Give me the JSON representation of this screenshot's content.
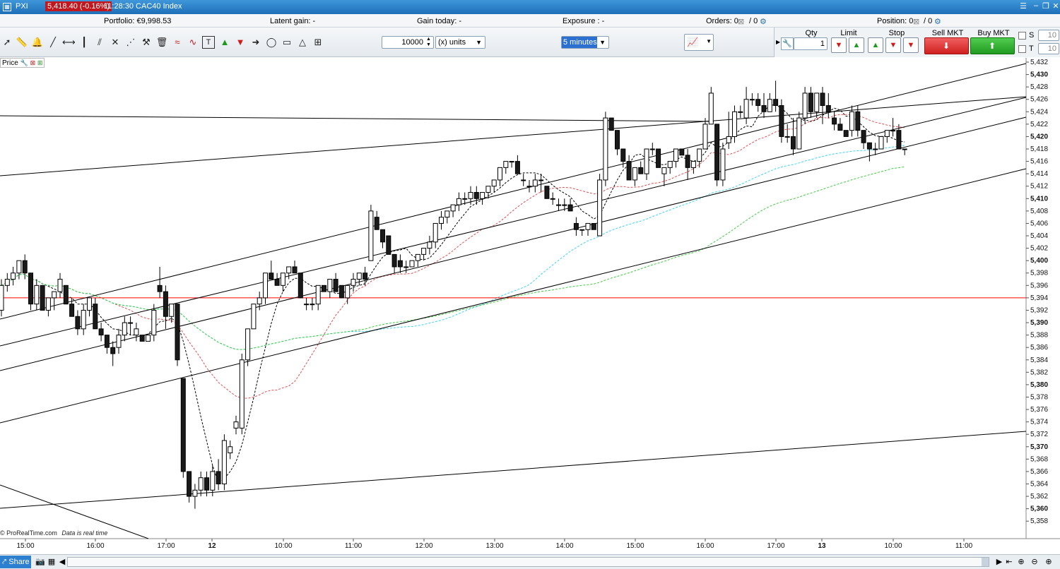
{
  "titlebar": {
    "symbol": "PXI",
    "last_price": "5,418.40 (-0.16%)",
    "info": "11:28:30 CAC40 Index"
  },
  "status": {
    "portfolio": "Portfolio: €9,998.53",
    "latent": "Latent gain: -",
    "gain_today": "Gain today: -",
    "exposure": "Exposure : -",
    "orders_label": "Orders: 0",
    "orders_sep": "/ 0",
    "position_label": "Position: 0",
    "position_sep": "/ 0"
  },
  "toolbar": {
    "quantity_value": "10000",
    "units_label": "(x) units",
    "timeframe": "5 minutes"
  },
  "order_panel": {
    "qty_label": "Qty",
    "qty_value": "1",
    "limit_label": "Limit",
    "stop_label": "Stop",
    "sell_label": "Sell MKT",
    "buy_label": "Buy MKT",
    "s_label": "S",
    "t_label": "T",
    "s_value": "10",
    "t_value": "10"
  },
  "chart_header": {
    "price_label": "Price"
  },
  "credit": {
    "brand": "© ProRealTime.com",
    "note": "Data is real time"
  },
  "footer": {
    "share_label": "Share"
  },
  "chart_data": {
    "type": "candlestick",
    "y_axis": {
      "min": 5357,
      "max": 5432,
      "ticks": [
        "5,432",
        "5,430",
        "5,428",
        "5,426",
        "5,424",
        "5,422",
        "5,420",
        "5,418",
        "5,416",
        "5,414",
        "5,412",
        "5,410",
        "5,408",
        "5,406",
        "5,404",
        "5,402",
        "5,400",
        "5,398",
        "5,396",
        "5,394",
        "5,392",
        "5,390",
        "5,388",
        "5,386",
        "5,384",
        "5,382",
        "5,380",
        "5,378",
        "5,376",
        "5,374",
        "5,372",
        "5,370",
        "5,368",
        "5,366",
        "5,364",
        "5,362",
        "5,360",
        "5,358"
      ]
    },
    "x_axis": {
      "labels": [
        "15:00",
        "16:00",
        "17:00",
        "12",
        "10:00",
        "11:00",
        "12:00",
        "13:00",
        "14:00",
        "15:00",
        "16:00",
        "17:00",
        "13",
        "10:00",
        "11:00"
      ]
    },
    "reference_line": 5394,
    "candles": [
      [
        5392,
        5397,
        5391,
        5396
      ],
      [
        5396,
        5398,
        5395,
        5397
      ],
      [
        5397,
        5399,
        5396,
        5398
      ],
      [
        5398,
        5400,
        5397,
        5400
      ],
      [
        5400,
        5401,
        5397,
        5398
      ],
      [
        5398,
        5398,
        5392,
        5393
      ],
      [
        5393,
        5397,
        5392,
        5396
      ],
      [
        5396,
        5396,
        5392,
        5392
      ],
      [
        5392,
        5394,
        5391,
        5394
      ],
      [
        5394,
        5395,
        5392,
        5395
      ],
      [
        5395,
        5398,
        5394,
        5397
      ],
      [
        5396,
        5396,
        5393,
        5393
      ],
      [
        5393,
        5394,
        5391,
        5391
      ],
      [
        5391,
        5392,
        5388,
        5389
      ],
      [
        5389,
        5393,
        5388,
        5392
      ],
      [
        5392,
        5394,
        5391,
        5394
      ],
      [
        5393,
        5394,
        5389,
        5389
      ],
      [
        5389,
        5390,
        5387,
        5388
      ],
      [
        5388,
        5388,
        5385,
        5386
      ],
      [
        5386,
        5387,
        5383,
        5385
      ],
      [
        5386,
        5389,
        5385,
        5388
      ],
      [
        5388,
        5391,
        5387,
        5390
      ],
      [
        5390,
        5391,
        5388,
        5390
      ],
      [
        5388,
        5390,
        5387,
        5389
      ],
      [
        5388,
        5388,
        5387,
        5387
      ],
      [
        5387,
        5388,
        5387,
        5388
      ],
      [
        5388,
        5393,
        5387,
        5392
      ],
      [
        5396,
        5399,
        5394,
        5395
      ],
      [
        5395,
        5396,
        5389,
        5391
      ],
      [
        5391,
        5393,
        5390,
        5393
      ],
      [
        5393,
        5393,
        5383,
        5384
      ],
      [
        5381,
        5381,
        5365,
        5366
      ],
      [
        5366,
        5366,
        5361,
        5362
      ],
      [
        5362,
        5364,
        5360,
        5363
      ],
      [
        5363,
        5366,
        5362,
        5365
      ],
      [
        5365,
        5366,
        5362,
        5363
      ],
      [
        5363,
        5367,
        5362,
        5366
      ],
      [
        5366,
        5368,
        5363,
        5364
      ],
      [
        5364,
        5372,
        5363,
        5371
      ],
      [
        5369,
        5371,
        5368,
        5370
      ],
      [
        5373,
        5375,
        5372,
        5374
      ],
      [
        5373,
        5385,
        5372,
        5384
      ],
      [
        5384,
        5389,
        5383,
        5389
      ],
      [
        5389,
        5393,
        5389,
        5393
      ],
      [
        5393,
        5395,
        5392,
        5394
      ],
      [
        5394,
        5398,
        5393,
        5398
      ],
      [
        5398,
        5400,
        5397,
        5397
      ],
      [
        5397,
        5398,
        5396,
        5396
      ],
      [
        5396,
        5398,
        5395,
        5398
      ],
      [
        5398,
        5399,
        5397,
        5399
      ],
      [
        5399,
        5400,
        5398,
        5398
      ],
      [
        5398,
        5398,
        5394,
        5394
      ],
      [
        5393,
        5394,
        5392,
        5393
      ],
      [
        5393,
        5394,
        5392,
        5393
      ],
      [
        5393,
        5396,
        5392,
        5396
      ],
      [
        5396,
        5396,
        5395,
        5395
      ],
      [
        5395,
        5397,
        5394,
        5397
      ],
      [
        5397,
        5398,
        5395,
        5395
      ],
      [
        5396,
        5396,
        5394,
        5394
      ],
      [
        5394,
        5396,
        5393,
        5396
      ],
      [
        5396,
        5398,
        5395,
        5397
      ],
      [
        5397,
        5398,
        5396,
        5398
      ],
      [
        5398,
        5399,
        5396,
        5397
      ],
      [
        5400,
        5409,
        5400,
        5408
      ],
      [
        5407,
        5408,
        5405,
        5405
      ],
      [
        5405,
        5405,
        5402,
        5403
      ],
      [
        5404,
        5404,
        5401,
        5401
      ],
      [
        5401,
        5401,
        5398,
        5399
      ],
      [
        5400,
        5401,
        5398,
        5399
      ],
      [
        5399,
        5400,
        5398,
        5399
      ],
      [
        5399,
        5400,
        5399,
        5400
      ],
      [
        5400,
        5401,
        5399,
        5401
      ],
      [
        5401,
        5402,
        5400,
        5402
      ],
      [
        5402,
        5404,
        5401,
        5403
      ],
      [
        5403,
        5406,
        5402,
        5406
      ],
      [
        5406,
        5408,
        5405,
        5407
      ],
      [
        5407,
        5408,
        5406,
        5408
      ],
      [
        5408,
        5409,
        5407,
        5409
      ],
      [
        5409,
        5411,
        5408,
        5410
      ],
      [
        5410,
        5411,
        5409,
        5410
      ],
      [
        5410,
        5412,
        5409,
        5411
      ],
      [
        5411,
        5412,
        5409,
        5410
      ],
      [
        5410,
        5411,
        5409,
        5411
      ],
      [
        5411,
        5412,
        5410,
        5412
      ],
      [
        5412,
        5413,
        5411,
        5413
      ],
      [
        5413,
        5415,
        5412,
        5415
      ],
      [
        5415,
        5416,
        5414,
        5416
      ],
      [
        5416,
        5416,
        5415,
        5416
      ],
      [
        5416,
        5417,
        5414,
        5414
      ],
      [
        5413,
        5414,
        5412,
        5413
      ],
      [
        5412,
        5413,
        5411,
        5412
      ],
      [
        5412,
        5414,
        5411,
        5413
      ],
      [
        5413,
        5414,
        5411,
        5413
      ],
      [
        5412,
        5412,
        5410,
        5410
      ],
      [
        5410,
        5411,
        5409,
        5410
      ],
      [
        5409,
        5410,
        5408,
        5409
      ],
      [
        5409,
        5410,
        5408,
        5409
      ],
      [
        5409,
        5410,
        5408,
        5408
      ],
      [
        5406,
        5407,
        5404,
        5405
      ],
      [
        5405,
        5405,
        5404,
        5405
      ],
      [
        5405,
        5406,
        5404,
        5406
      ],
      [
        5406,
        5406,
        5405,
        5405
      ],
      [
        5404,
        5414,
        5404,
        5413
      ],
      [
        5413,
        5424,
        5412,
        5423
      ],
      [
        5423,
        5423,
        5421,
        5421
      ],
      [
        5421,
        5421,
        5417,
        5418
      ],
      [
        5418,
        5418,
        5415,
        5416
      ],
      [
        5416,
        5417,
        5413,
        5413
      ],
      [
        5413,
        5415,
        5412,
        5415
      ],
      [
        5415,
        5416,
        5414,
        5414
      ],
      [
        5414,
        5418,
        5413,
        5418
      ],
      [
        5418,
        5419,
        5417,
        5418
      ],
      [
        5418,
        5418,
        5415,
        5415
      ],
      [
        5414,
        5415,
        5412,
        5415
      ],
      [
        5415,
        5416,
        5414,
        5416
      ],
      [
        5416,
        5418,
        5415,
        5418
      ],
      [
        5418,
        5418,
        5417,
        5417
      ],
      [
        5417,
        5418,
        5413,
        5415
      ],
      [
        5415,
        5416,
        5414,
        5416
      ],
      [
        5416,
        5418,
        5415,
        5418
      ],
      [
        5418,
        5423,
        5418,
        5422
      ],
      [
        5422,
        5428,
        5422,
        5427
      ],
      [
        5422,
        5422,
        5412,
        5413
      ],
      [
        5413,
        5419,
        5412,
        5418
      ],
      [
        5419,
        5424,
        5418,
        5420
      ],
      [
        5420,
        5425,
        5419,
        5424
      ],
      [
        5424,
        5425,
        5423,
        5424
      ],
      [
        5423,
        5428,
        5422,
        5426
      ],
      [
        5426,
        5427,
        5425,
        5426
      ],
      [
        5426,
        5427,
        5424,
        5425
      ],
      [
        5425,
        5427,
        5423,
        5424
      ],
      [
        5424,
        5427,
        5424,
        5426
      ],
      [
        5426,
        5429,
        5424,
        5425
      ],
      [
        5425,
        5426,
        5419,
        5420
      ],
      [
        5420,
        5422,
        5419,
        5420
      ],
      [
        5420,
        5423,
        5417,
        5418
      ],
      [
        5418,
        5424,
        5418,
        5423
      ],
      [
        5423,
        5428,
        5422,
        5427
      ],
      [
        5427,
        5428,
        5423,
        5424
      ],
      [
        5424,
        5427,
        5423,
        5427
      ],
      [
        5427,
        5428,
        5422,
        5425
      ],
      [
        5425,
        5427,
        5423,
        5424
      ],
      [
        5423,
        5424,
        5421,
        5422
      ],
      [
        5422,
        5423,
        5421,
        5421
      ],
      [
        5421,
        5421,
        5420,
        5420
      ],
      [
        5421,
        5425,
        5420,
        5424
      ],
      [
        5424,
        5425,
        5420,
        5421
      ],
      [
        5421,
        5421,
        5418,
        5419
      ],
      [
        5419,
        5419,
        5416,
        5418
      ],
      [
        5418,
        5419,
        5417,
        5418
      ],
      [
        5418,
        5420,
        5418,
        5420
      ],
      [
        5420,
        5421,
        5419,
        5421
      ],
      [
        5421,
        5423,
        5420,
        5421
      ],
      [
        5421,
        5422,
        5418,
        5418
      ],
      [
        5418,
        5418,
        5417,
        5418
      ]
    ]
  },
  "colors": {
    "title_blue": "#2b82cc",
    "price_red": "#c0181e",
    "sell_red": "#e03a3a",
    "buy_green": "#2faa2f",
    "ref_line": "#ff0000",
    "ma_black": "#000000",
    "ma_red": "#e05050",
    "ma_cyan": "#40d0ff",
    "ma_green": "#40cc40"
  }
}
